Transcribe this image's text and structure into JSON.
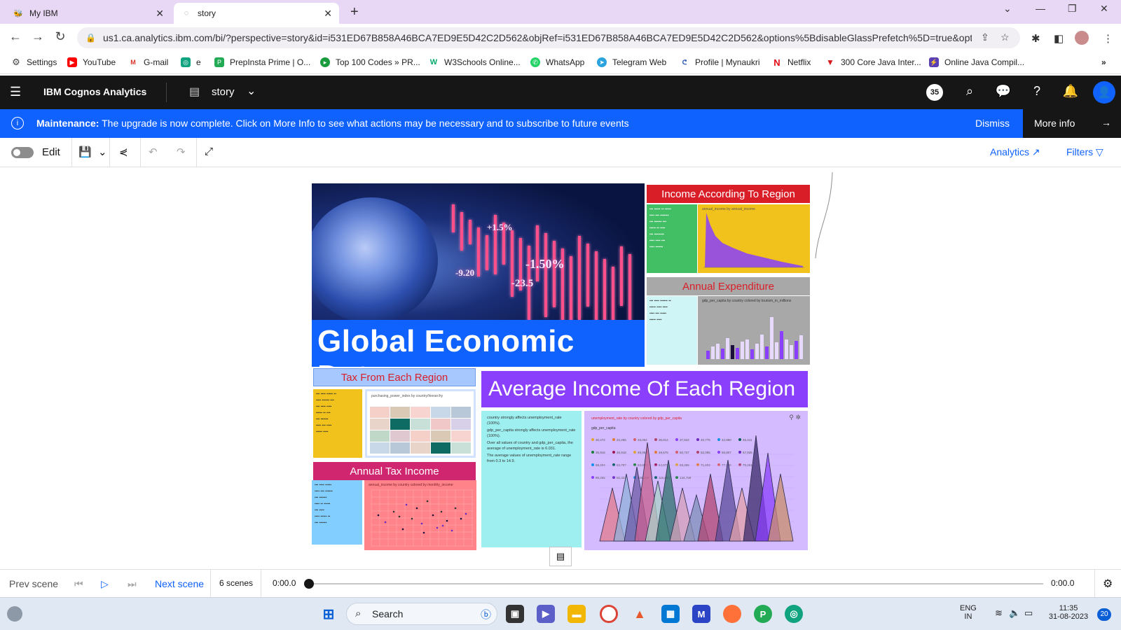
{
  "browser": {
    "tabs": [
      {
        "title": "My IBM",
        "active": false
      },
      {
        "title": "story",
        "active": true
      }
    ],
    "url": "us1.ca.analytics.ibm.com/bi/?perspective=story&id=i531ED67B858A46BCA7ED9E5D42C2D562&objRef=i531ED67B858A46BCA7ED9E5D42C2D562&options%5BdisableGlassPrefetch%5D=true&options...",
    "bookmarks": [
      {
        "label": "Settings",
        "icon": "gear-icon",
        "color": "#444444"
      },
      {
        "label": "YouTube",
        "icon": "youtube-icon",
        "color": "#ff0000"
      },
      {
        "label": "G-mail",
        "icon": "gmail-icon",
        "color": "#d93025"
      },
      {
        "label": "e",
        "icon": "chatgpt-icon",
        "color": "#10a37f"
      },
      {
        "label": "PrepInsta Prime | O...",
        "icon": "prepinsta-icon",
        "color": "#22aa55"
      },
      {
        "label": "Top 100 Codes » PR...",
        "icon": "prepinsta-icon",
        "color": "#1a9c3e"
      },
      {
        "label": "W3Schools Online...",
        "icon": "w3schools-icon",
        "color": "#04aa6d"
      },
      {
        "label": "WhatsApp",
        "icon": "whatsapp-icon",
        "color": "#25d366"
      },
      {
        "label": "Telegram Web",
        "icon": "telegram-icon",
        "color": "#2aa3df"
      },
      {
        "label": "Profile | Mynaukri",
        "icon": "naukri-icon",
        "color": "#1c4ca8"
      },
      {
        "label": "Netflix",
        "icon": "netflix-icon",
        "color": "#e50914"
      },
      {
        "label": "300 Core Java Inter...",
        "icon": "javatpoint-icon",
        "color": "#d7191c"
      },
      {
        "label": "Online Java Compil...",
        "icon": "compiler-icon",
        "color": "#5b3fb5"
      }
    ]
  },
  "app": {
    "brand": "IBM Cognos Analytics",
    "story_name": "story",
    "notification_count": "35"
  },
  "banner": {
    "label": "Maintenance:",
    "message": "The upgrade is now complete. Click on More Info to see what actions may be necessary and to subscribe to future events",
    "dismiss": "Dismiss",
    "more_info": "More info"
  },
  "toolbar": {
    "edit_label": "Edit",
    "analytics_label": "Analytics",
    "filters_label": "Filters"
  },
  "story": {
    "hero_title": "Global Economic Data",
    "hero_numbers": [
      "+1.5%",
      "-1.50%",
      "-9.20",
      "-23.5"
    ],
    "income_region_title": "Income According To Region",
    "annual_expenditure_title": "Annual Expenditure",
    "tax_region_title": "Tax From Each Region",
    "annual_tax_title": "Annual Tax Income",
    "avg_income_title": "Average Income Of Each Region",
    "avg_income_insights": [
      "country strongly affects unemployment_rate (100%).",
      "gdp_per_capita strongly affects unemployment_rate (100%).",
      "Over all values of country and gdp_per_capita, the average of unemployment_rate is 6.031.",
      "The average values of unemployment_rate range from 0.3 to 14.9."
    ],
    "avg_income_chart_title": "unemployment_rate by country colored by gdp_per_capita",
    "avg_income_legend_title": "gdp_per_capita",
    "avg_income_legend": [
      "30,472",
      "22,255",
      "33,062",
      "35,814",
      "37,622",
      "40,775",
      "42,990",
      "45,411",
      "35,916",
      "46,918",
      "49,063",
      "49,675",
      "50,737",
      "52,095",
      "55,807",
      "57,935",
      "59,204",
      "62,787",
      "63,693",
      "64,972",
      "68,256",
      "71,602",
      "77,304",
      "79,261",
      "85,255",
      "92,321",
      "105,458",
      "115,880",
      "134,759"
    ],
    "income_chart_title": "annual_income by annual_income",
    "expend_chart_title": "gdp_per_capita by country colored by tourism_in_millions",
    "tax_chart_title": "purchasing_power_index by country/hierarchy",
    "tax_scatter_title": "annual_income by country colored by monthly_income"
  },
  "player": {
    "prev": "Prev scene",
    "next": "Next scene",
    "scenes": "6 scenes",
    "time_start": "0:00.0",
    "time_end": "0:00.0"
  },
  "taskbar": {
    "search": "Search",
    "lang": "ENG",
    "region": "IN",
    "time": "11:35",
    "date": "31-08-2023",
    "notif": "20"
  }
}
